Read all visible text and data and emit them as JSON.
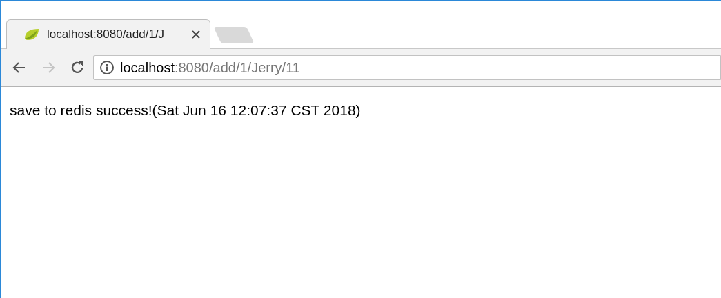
{
  "tabs": [
    {
      "title": "localhost:8080/add/1/J",
      "selected": true
    }
  ],
  "toolbar": {
    "back": {
      "disabled": false
    },
    "forward": {
      "disabled": true
    },
    "reload": {
      "disabled": false
    }
  },
  "address_bar": {
    "host": "localhost",
    "path": ":8080/add/1/Jerry/11"
  },
  "page": {
    "text": "save to redis success!(Sat Jun 16 12:07:37 CST 2018)"
  }
}
